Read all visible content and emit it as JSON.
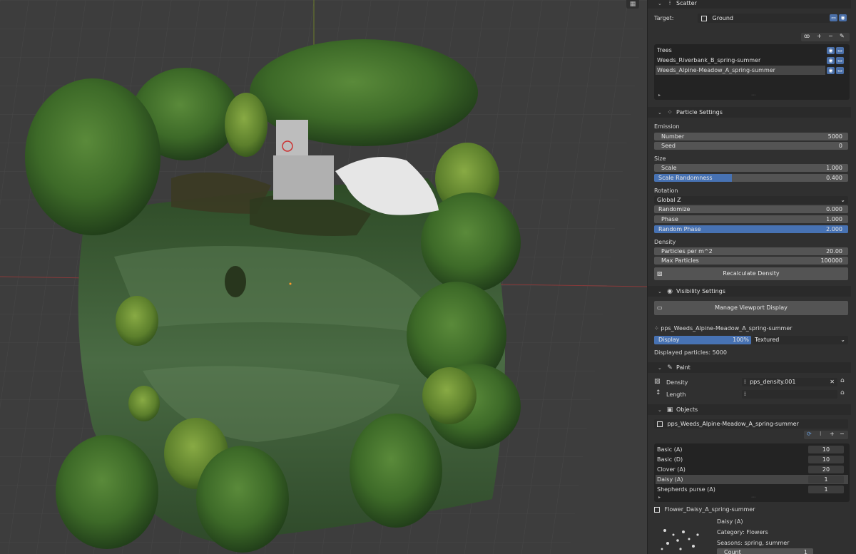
{
  "scatter": {
    "header": "Scatter",
    "target_label": "Target:",
    "target_value": "Ground",
    "systems": [
      {
        "label": "Trees",
        "active": false
      },
      {
        "label": "Weeds_Riverbank_B_spring-summer",
        "active": false
      },
      {
        "label": "Weeds_Alpine-Meadow_A_spring-summer",
        "active": true
      }
    ]
  },
  "particle": {
    "header": "Particle Settings",
    "emission_label": "Emission",
    "number_label": "Number",
    "number_value": "5000",
    "seed_label": "Seed",
    "seed_value": "0",
    "size_label": "Size",
    "scale_label": "Scale",
    "scale_value": "1.000",
    "scale_rand_label": "Scale Randomness",
    "scale_rand_value": "0.400",
    "scale_rand_fraction": 0.4,
    "rotation_label": "Rotation",
    "rotation_mode": "Global Z",
    "randomize_label": "Randomize",
    "randomize_value": "0.000",
    "phase_label": "Phase",
    "phase_value": "1.000",
    "random_phase_label": "Random Phase",
    "random_phase_value": "2.000",
    "density_label": "Density",
    "ppm_label": "Particles per m^2",
    "ppm_value": "20.00",
    "max_label": "Max Particles",
    "max_value": "100000",
    "recalc_label": "Recalculate Density"
  },
  "visibility": {
    "header": "Visibility Settings",
    "manage_label": "Manage Viewport Display",
    "system_name": "pps_Weeds_Alpine-Meadow_A_spring-summer",
    "display_label": "Display",
    "display_value": "100%",
    "display_fraction": 1.0,
    "display_mode": "Textured",
    "displayed_particles": "Displayed particles: 5000"
  },
  "paint": {
    "header": "Paint",
    "density_label": "Density",
    "density_value": "pps_density.001",
    "length_label": "Length",
    "length_value": ""
  },
  "objects": {
    "header": "Objects",
    "collection_name": "pps_Weeds_Alpine-Meadow_A_spring-summer",
    "items": [
      {
        "name": "Basic (A)",
        "count": "10",
        "active": false
      },
      {
        "name": "Basic (D)",
        "count": "10",
        "active": false
      },
      {
        "name": "Clover (A)",
        "count": "20",
        "active": false
      },
      {
        "name": "Daisy (A)",
        "count": "1",
        "active": true
      },
      {
        "name": "Shepherds purse (A)",
        "count": "1",
        "active": false
      }
    ],
    "selected_object": "Flower_Daisy_A_spring-summer",
    "detail_name": "Daisy (A)",
    "detail_category": "Category: Flowers",
    "detail_seasons": "Seasons: spring, summer",
    "count_label": "Count",
    "count_value": "1"
  },
  "icons": {
    "collapse": "chevron-down-icon",
    "camera": "camera-icon",
    "monitor": "monitor-icon",
    "add": "plus-icon",
    "remove": "minus-icon",
    "edit": "pencil-icon",
    "eye": "eye-icon",
    "brush": "brush-icon",
    "refresh": "refresh-icon"
  },
  "colors": {
    "accent": "#4772b3",
    "panel_bg": "#303030",
    "field_bg": "#545454",
    "viewport_bg": "#3d3d3d"
  }
}
